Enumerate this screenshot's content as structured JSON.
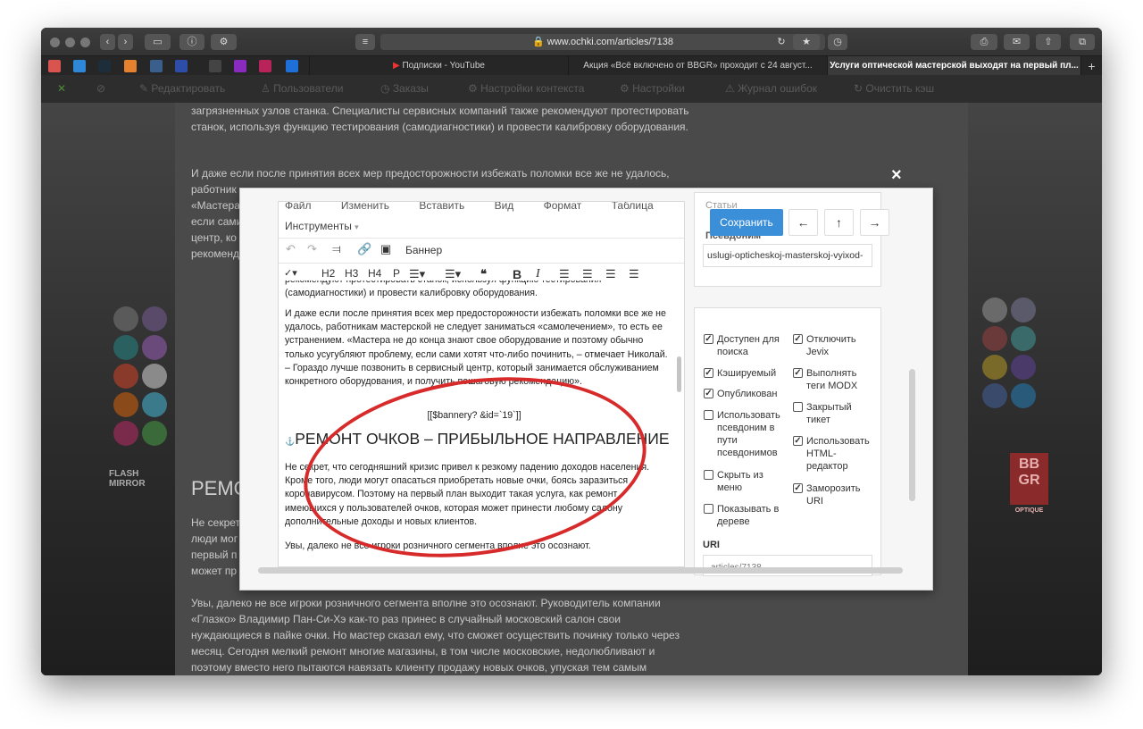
{
  "browser": {
    "url": "www.ochki.com/articles/7138",
    "tabs": [
      {
        "label": "Подписки - YouTube",
        "active": false
      },
      {
        "label": "Акция «Всё включено от BBGR» проходит с 24 август...",
        "active": false
      },
      {
        "label": "Услуги оптической мастерской выходят на первый пл...",
        "active": true
      }
    ]
  },
  "modx_toolbar": {
    "items": [
      "Редактировать",
      "Пользователи",
      "Заказы",
      "Настройки контекста",
      "Настройки",
      "Журнал ошибок",
      "Очистить кэш"
    ]
  },
  "article": {
    "paragraphs": [
      "загрязненных узлов станка. Специалисты сервисных компаний также рекомендуют протестировать станок, используя функцию тестирования (самодиагностики) и провести калибровку оборудования.",
      "И даже если после принятия всех мер предосторожности избежать поломки все же не удалось, работник",
      "«Мастера",
      "если сами",
      "центр, ко",
      "рекоменд"
    ],
    "heading_partial": "РЕМО",
    "side_lines": [
      "Не секрет",
      "люди мог",
      "первый п",
      "может пр"
    ],
    "lower_paragraph": "Увы, далеко не все игроки розничного сегмента вполне это осознают. Руководитель компании «Глазко» Владимир Пан-Си-Хэ как-то раз принес в случайный московский салон свои нуждающиеся в пайке очки. Но мастер сказал ему, что сможет осуществить починку только через месяц. Сегодня мелкий ремонт многие магазины, в том числе московские, недолюбливают и поэтому вместо него пытаются навязать клиенту продажу новых очков, упуская тем самым",
    "left_banner_brand": "FLASH MIRROR",
    "right_banner_brand": "BB GR",
    "right_banner_sub": "OPTIQUE"
  },
  "modal": {
    "close_glyph": "×",
    "editor": {
      "menu_items": [
        "Файл",
        "Изменить",
        "Вставить",
        "Вид",
        "Формат",
        "Таблица"
      ],
      "tools_menu": "Инструменты",
      "banner_label": "Баннер",
      "format_buttons": [
        "H2",
        "H3",
        "H4",
        "P"
      ],
      "content": {
        "top_partial": "рекомендуют протестировать станок, используя функцию тестирования (самодиагностики) и провести калибровку оборудования.",
        "para1": "И даже если после принятия всех мер предосторожности избежать поломки все же не удалось, работникам мастерской не следует заниматься «самолечением», то есть ее устранением. «Мастера не до конца знают свое оборудование и поэтому обычно только усугубляют проблему, если сами хотят что-либо починить, – отмечает Николай. – Гораздо лучше позвонить в сервисный центр, который занимается обслуживанием конкретного оборудования, и получить пошаговую рекомендацию».",
        "snippet": "[[$bannery? &id=`19`]]",
        "heading": "РЕМОНТ ОЧКОВ – ПРИБЫЛЬНОЕ НАПРАВЛЕНИЕ",
        "para2": "Не секрет, что сегодняшний кризис привел к резкому падению доходов населения. Кроме того, люди могут опасаться приобретать новые очки, боясь заразиться коронавирусом. Поэтому на первый план выходит такая услуга, как ремонт имеющихся у пользователей очков, которая может принести любому салону дополнительные доходы и новых клиентов.",
        "para3": "Увы, далеко не все игроки розничного сегмента вполне это осознают."
      }
    },
    "sidebar": {
      "category_partial": "Статьи",
      "alias_label_partial": "Псевдоним",
      "save_button": "Сохранить",
      "alias_value": "uslugi-opticheskoj-masterskoj-vyixod-",
      "checkboxes_left": [
        {
          "label": "Доступен для поиска",
          "checked": true
        },
        {
          "label": "Кэшируемый",
          "checked": true
        },
        {
          "label": "Опубликован",
          "checked": true
        },
        {
          "label": "Использовать псевдоним в пути псевдонимов",
          "checked": false
        },
        {
          "label": "Скрыть из меню",
          "checked": false
        },
        {
          "label": "Показывать в дереве",
          "checked": false
        }
      ],
      "checkboxes_right": [
        {
          "label": "Отключить Jevix",
          "checked": true
        },
        {
          "label": "Выполнять теги MODX",
          "checked": true
        },
        {
          "label": "Закрытый тикет",
          "checked": false
        },
        {
          "label": "Использовать HTML-редактор",
          "checked": true
        },
        {
          "label": "Заморозить URI",
          "checked": true
        }
      ],
      "uri_label": "URI",
      "uri_value_partial": "articles/7138"
    }
  }
}
